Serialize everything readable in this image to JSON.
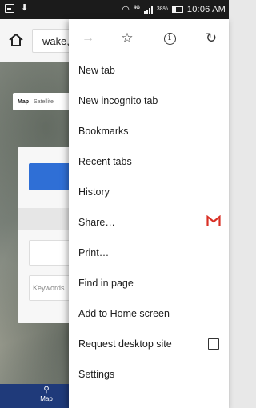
{
  "status_bar": {
    "network": "4G",
    "battery": "38%",
    "time": "10:06 AM"
  },
  "browser": {
    "omnibox_text": "wake,"
  },
  "page": {
    "map_tabs": [
      "Map",
      "Satellite"
    ],
    "keyword_placeholder": "Keywords",
    "bottom_nav_label": "Map"
  },
  "menu": {
    "icons": [
      "forward-icon",
      "bookmark-star-icon",
      "page-info-icon",
      "reload-icon"
    ],
    "items": [
      {
        "label": "New tab"
      },
      {
        "label": "New incognito tab"
      },
      {
        "label": "Bookmarks"
      },
      {
        "label": "Recent tabs"
      },
      {
        "label": "History"
      },
      {
        "label": "Share…",
        "icon": "gmail-icon"
      },
      {
        "label": "Print…"
      },
      {
        "label": "Find in page"
      },
      {
        "label": "Add to Home screen"
      },
      {
        "label": "Request desktop site",
        "checked": false
      },
      {
        "label": "Settings"
      }
    ]
  },
  "colors": {
    "gmail_red": "#d93025",
    "bottom_nav": "#1f3a7a",
    "button_blue": "#2f6fd6"
  }
}
